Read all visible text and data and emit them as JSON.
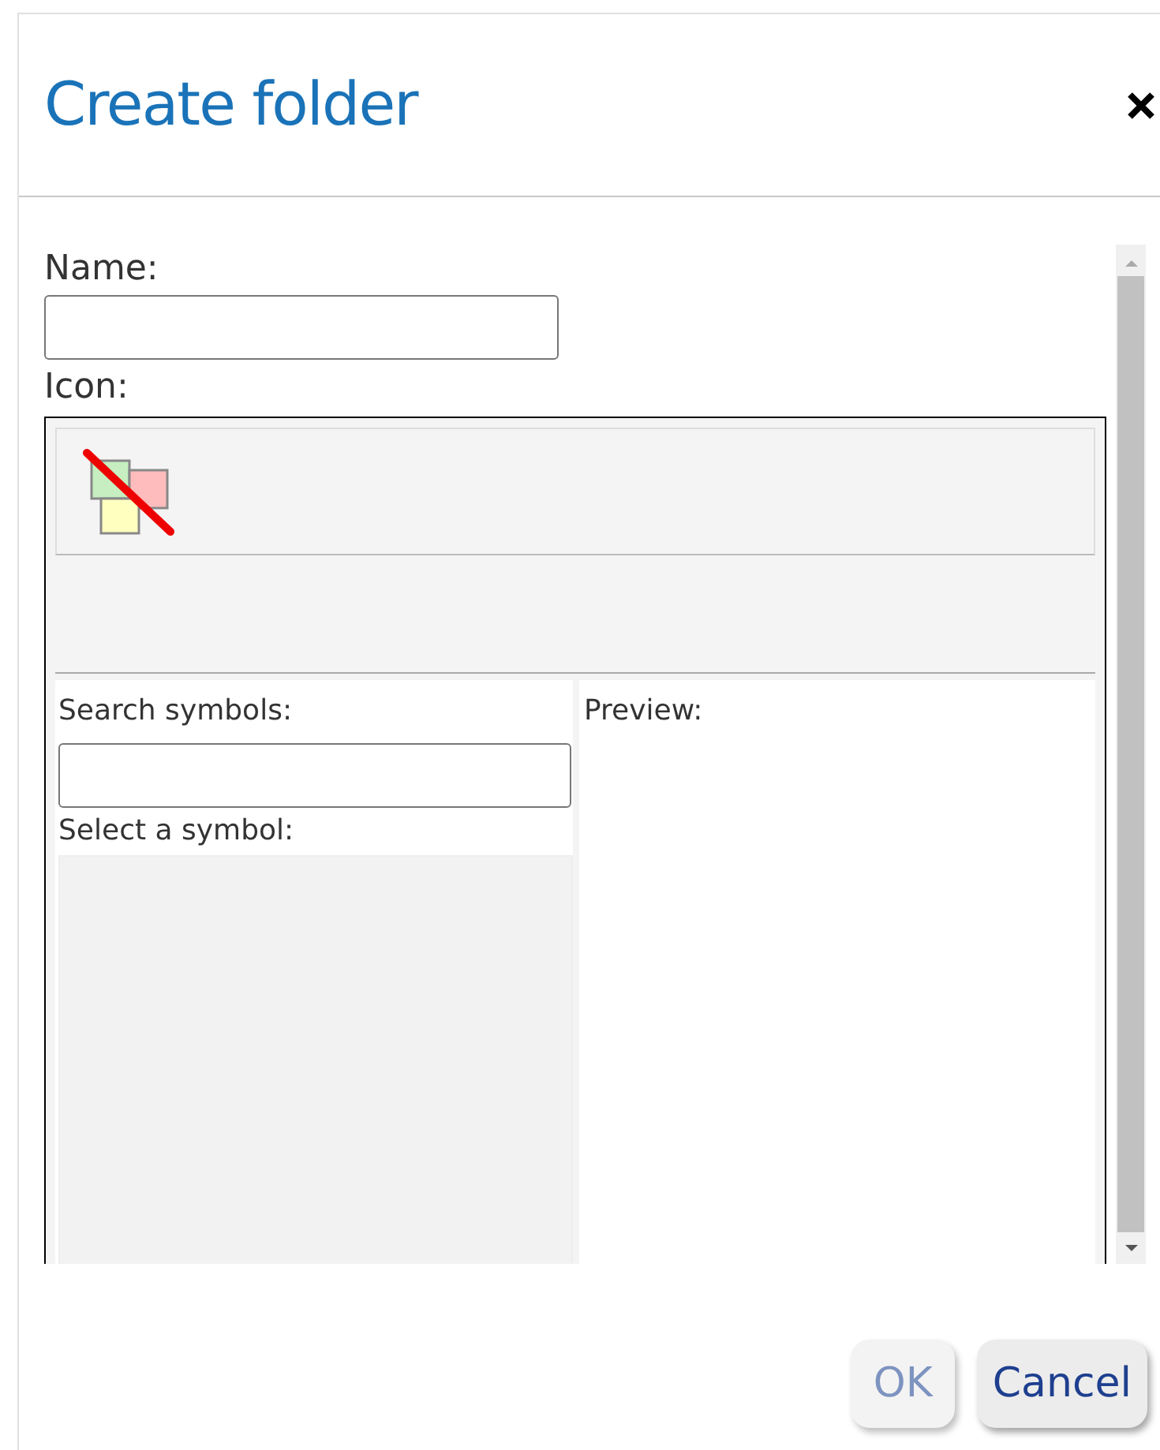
{
  "dialog": {
    "title": "Create folder"
  },
  "form": {
    "name_label": "Name:",
    "icon_label": "Icon:"
  },
  "symbol_picker": {
    "search_label": "Search symbols:",
    "select_label": "Select a symbol:",
    "preview_label": "Preview:"
  },
  "buttons": [
    {
      "label": "OK",
      "disabled": true
    },
    {
      "label": "Cancel",
      "disabled": false
    }
  ]
}
